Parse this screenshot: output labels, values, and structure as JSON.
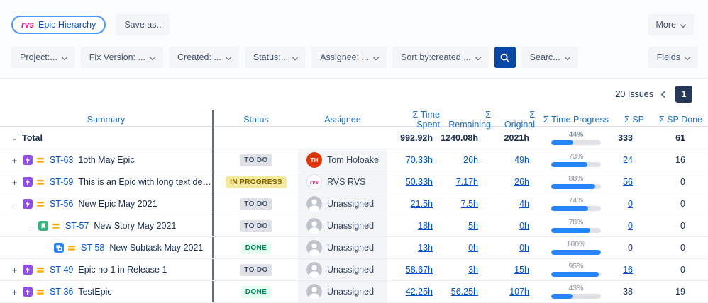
{
  "toolbar": {
    "logo_text": "rvs",
    "app_button": "Epic Hierarchy",
    "save_as": "Save as..",
    "more": "More"
  },
  "filters": {
    "items": [
      "Project:...",
      "Fix Version: ...",
      "Created: ...",
      "Status:...",
      "Assignee: ...",
      "Sort by:created ..."
    ],
    "search_pill": "Searc...",
    "fields": "Fields"
  },
  "pagination": {
    "issues_count": "20 Issues",
    "page": "1"
  },
  "table": {
    "columns": [
      "Summary",
      "Status",
      "Assignee",
      "Σ Time Spent",
      "Σ Remaining",
      "Σ Original",
      "Σ Time Progress",
      "Σ SP",
      "Σ SP Done"
    ],
    "total": {
      "expander": "-",
      "label": "Total",
      "time_spent": "992.92h",
      "remaining": "1240.08h",
      "original": "2021h",
      "progress": 44,
      "sp": "333",
      "sp_done": "61"
    },
    "rows": [
      {
        "level": 0,
        "expander": "+",
        "type": "epic",
        "key": "ST-63",
        "summary": "1oth May Epic",
        "struck": false,
        "status": "TO DO",
        "assignee": {
          "kind": "user",
          "text": "TH",
          "name": "Tom Holoake"
        },
        "time_spent": "70.33h",
        "remaining": "26h",
        "original": "49h",
        "progress": 73,
        "sp": "24",
        "sp_link": true,
        "sp_done": "16"
      },
      {
        "level": 0,
        "expander": "+",
        "type": "epic",
        "key": "ST-59",
        "summary": "This is an Epic with long text description",
        "struck": false,
        "status": "IN PROGRESS",
        "assignee": {
          "kind": "logo",
          "text": "rvs",
          "name": "RVS RVS"
        },
        "time_spent": "50.33h",
        "remaining": "7.17h",
        "original": "26h",
        "progress": 88,
        "sp": "56",
        "sp_link": true,
        "sp_done": "0"
      },
      {
        "level": 0,
        "expander": "-",
        "type": "epic",
        "key": "ST-56",
        "summary": "New Epic May 2021",
        "struck": false,
        "status": "TO DO",
        "assignee": {
          "kind": "none",
          "text": "",
          "name": "Unassigned"
        },
        "time_spent": "21.5h",
        "remaining": "7.5h",
        "original": "4h",
        "progress": 74,
        "sp": "0",
        "sp_link": true,
        "sp_done": "0"
      },
      {
        "level": 1,
        "expander": "-",
        "type": "story",
        "key": "ST-57",
        "summary": "New Story May 2021",
        "struck": false,
        "status": "TO DO",
        "assignee": {
          "kind": "none",
          "text": "",
          "name": "Unassigned"
        },
        "time_spent": "18h",
        "remaining": "5h",
        "original": "0h",
        "progress": 78,
        "sp": "0",
        "sp_link": true,
        "sp_done": "0"
      },
      {
        "level": 2,
        "expander": "",
        "type": "subtask",
        "key": "ST-58",
        "summary": "New Subtask May 2021",
        "struck": true,
        "status": "DONE",
        "assignee": {
          "kind": "none",
          "text": "",
          "name": "Unassigned"
        },
        "time_spent": "13h",
        "remaining": "0h",
        "original": "0h",
        "progress": 100,
        "sp": "0",
        "sp_link": false,
        "sp_done": "0"
      },
      {
        "level": 0,
        "expander": "+",
        "type": "epic",
        "key": "ST-49",
        "summary": "Epic no 1 in Release 1",
        "struck": false,
        "status": "TO DO",
        "assignee": {
          "kind": "none",
          "text": "",
          "name": "Unassigned"
        },
        "time_spent": "58.67h",
        "remaining": "3h",
        "original": "15h",
        "progress": 95,
        "sp": "16",
        "sp_link": true,
        "sp_done": "0"
      },
      {
        "level": 0,
        "expander": "+",
        "type": "epic",
        "key": "ST-36",
        "summary": "TestEpic",
        "struck": true,
        "status": "DONE",
        "assignee": {
          "kind": "none",
          "text": "",
          "name": "Unassigned"
        },
        "time_spent": "42.25h",
        "remaining": "56.25h",
        "original": "107h",
        "progress": 43,
        "sp": "38",
        "sp_link": false,
        "sp_done": "19"
      }
    ]
  },
  "colors": {
    "link": "#0052cc",
    "header_text": "#1d70c2",
    "progress_fill": "#2684ff",
    "badge_todo_bg": "#dfe1e6",
    "badge_inprogress_bg": "#f5e8a0",
    "badge_done_bg": "#e3fcef",
    "search_button_bg": "#0747a6",
    "pagination_active_bg": "#253858",
    "epic_purple": "#904ee2",
    "story_green": "#36b37e",
    "subtask_blue": "#2684ff",
    "priority_orange": "#ffab00",
    "logo_pink": "#e0197d"
  }
}
